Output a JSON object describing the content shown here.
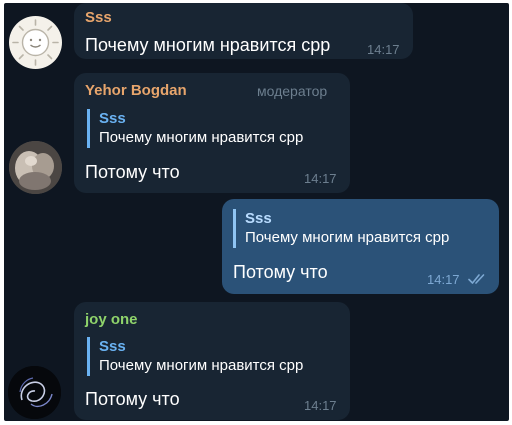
{
  "colors": {
    "background": "#0e1621",
    "incoming_bubble": "#182533",
    "outgoing_bubble": "#2b5278",
    "reply_accent": "#6ab2f2",
    "name_orange": "#e7a56c",
    "name_green": "#8fd36b",
    "meta_gray": "#6d7f8f"
  },
  "messages": [
    {
      "sender": "Sss",
      "sender_color": "#e7a56c",
      "text": "Почему многим нравится срр",
      "time": "14:17",
      "avatar_icon": "smiling-sun-icon"
    },
    {
      "sender": "Yehor Bogdan",
      "sender_color": "#e7a56c",
      "role": "модератор",
      "reply": {
        "name": "Sss",
        "text": "Почему многим нравится срр"
      },
      "text": "Потому что",
      "time": "14:17",
      "avatar_icon": "photo-avatar-icon"
    },
    {
      "outgoing": true,
      "reply": {
        "name": "Sss",
        "text": "Почему многим нравится срр"
      },
      "text": "Потому что",
      "time": "14:17",
      "status_icon": "double-check-icon"
    },
    {
      "sender": "joy one",
      "sender_color": "#8fd36b",
      "reply": {
        "name": "Sss",
        "text": "Почему многим нравится срр"
      },
      "text": "Потому что",
      "time": "14:17",
      "avatar_icon": "swirl-avatar-icon"
    }
  ]
}
